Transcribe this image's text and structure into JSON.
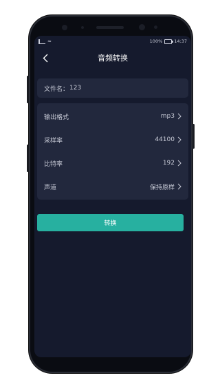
{
  "status_bar": {
    "left_icons": [
      "signal-icon",
      "wifi-icon"
    ],
    "battery_text": "100%",
    "time": "14:37"
  },
  "header": {
    "back_icon": "chevron-left-icon",
    "title": "音频转换"
  },
  "file": {
    "label": "文件名：",
    "value": "123"
  },
  "settings": {
    "items": [
      {
        "label": "输出格式",
        "value": "mp3"
      },
      {
        "label": "采样率",
        "value": "44100"
      },
      {
        "label": "比特率",
        "value": "192"
      },
      {
        "label": "声道",
        "value": "保持原样"
      }
    ]
  },
  "action": {
    "convert_label": "转换"
  },
  "colors": {
    "background": "#151a2d",
    "card": "#22283d",
    "accent": "#27b0a0"
  }
}
